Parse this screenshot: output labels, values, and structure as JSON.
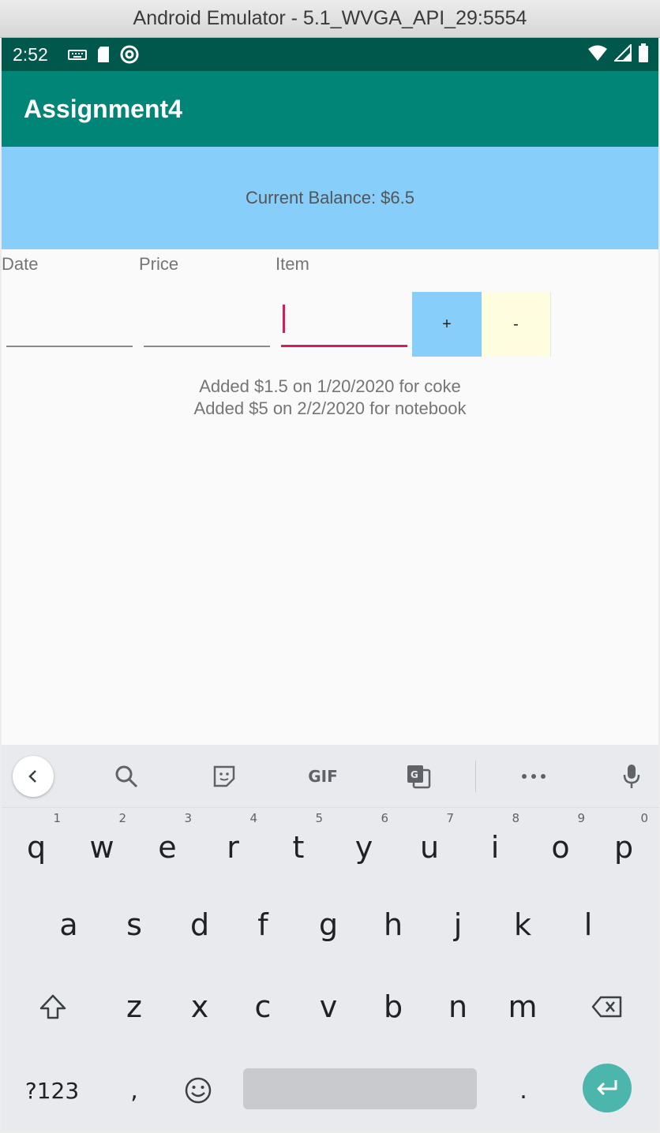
{
  "window": {
    "title": "Android Emulator - 5.1_WVGA_API_29:5554"
  },
  "status_bar": {
    "time": "2:52"
  },
  "app_bar": {
    "title": "Assignment4"
  },
  "balance": {
    "text": "Current Balance: $6.5"
  },
  "form": {
    "labels": {
      "date": "Date",
      "price": "Price",
      "item": "Item"
    },
    "date_value": "",
    "price_value": "",
    "item_value": "",
    "plus_label": "+",
    "minus_label": "-"
  },
  "log": [
    "Added $1.5 on 1/20/2020 for coke",
    "Added $5 on 2/2/2020 for notebook"
  ],
  "keyboard": {
    "toolbar": {
      "gif_label": "GIF"
    },
    "row1": [
      {
        "k": "q",
        "h": "1"
      },
      {
        "k": "w",
        "h": "2"
      },
      {
        "k": "e",
        "h": "3"
      },
      {
        "k": "r",
        "h": "4"
      },
      {
        "k": "t",
        "h": "5"
      },
      {
        "k": "y",
        "h": "6"
      },
      {
        "k": "u",
        "h": "7"
      },
      {
        "k": "i",
        "h": "8"
      },
      {
        "k": "o",
        "h": "9"
      },
      {
        "k": "p",
        "h": "0"
      }
    ],
    "row2": [
      "a",
      "s",
      "d",
      "f",
      "g",
      "h",
      "j",
      "k",
      "l"
    ],
    "row3": [
      "z",
      "x",
      "c",
      "v",
      "b",
      "n",
      "m"
    ],
    "symbols_label": "?123",
    "comma_label": ",",
    "period_label": "."
  },
  "colors": {
    "app_bar": "#008577",
    "status_bar": "#00574b",
    "balance_bg": "#87cefa",
    "minus_bg": "#fffde0",
    "accent": "#d81b60",
    "enter_key": "#4db6ac"
  }
}
